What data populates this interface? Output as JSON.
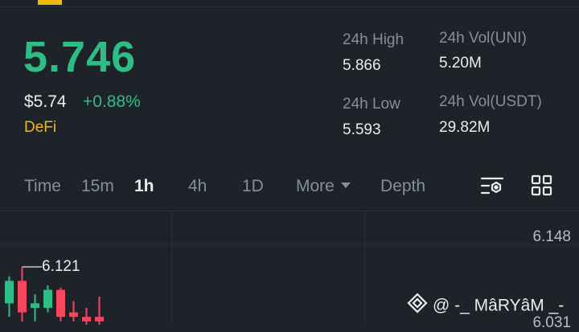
{
  "ticker": {
    "last_price": "5.746",
    "usd_price": "$5.74",
    "change_pct": "+0.88%",
    "tag": "DeFi"
  },
  "stats": {
    "high_label": "24h High",
    "high_value": "5.866",
    "low_label": "24h Low",
    "low_value": "5.593",
    "vol_base_label": "24h Vol(UNI)",
    "vol_base_value": "5.20M",
    "vol_quote_label": "24h Vol(USDT)",
    "vol_quote_value": "29.82M"
  },
  "intervals": {
    "time": "Time",
    "m15": "15m",
    "h1": "1h",
    "h4": "4h",
    "d1": "1D",
    "more": "More",
    "depth": "Depth",
    "active": "1h"
  },
  "chart": {
    "price_axis": [
      "6.148",
      "6.031"
    ],
    "peak_label": "6.121",
    "up_color": "#2ebd85",
    "down_color": "#f6465d",
    "candles": [
      {
        "open": 6.04,
        "close": 6.09,
        "high": 6.1,
        "low": 6.01
      },
      {
        "open": 6.09,
        "close": 6.02,
        "high": 6.121,
        "low": 6.0
      },
      {
        "open": 6.03,
        "close": 6.04,
        "high": 6.06,
        "low": 6.0
      },
      {
        "open": 6.03,
        "close": 6.07,
        "high": 6.08,
        "low": 6.02
      },
      {
        "open": 6.07,
        "close": 6.01,
        "high": 6.075,
        "low": 6.0
      },
      {
        "open": 6.02,
        "close": 6.01,
        "high": 6.045,
        "low": 6.0
      },
      {
        "open": 6.01,
        "close": 6.0,
        "high": 6.03,
        "low": 5.99
      },
      {
        "open": 6.01,
        "close": 6.0,
        "high": 6.055,
        "low": 5.99
      }
    ]
  },
  "watermark": "@ -_ MâRYâM _-"
}
